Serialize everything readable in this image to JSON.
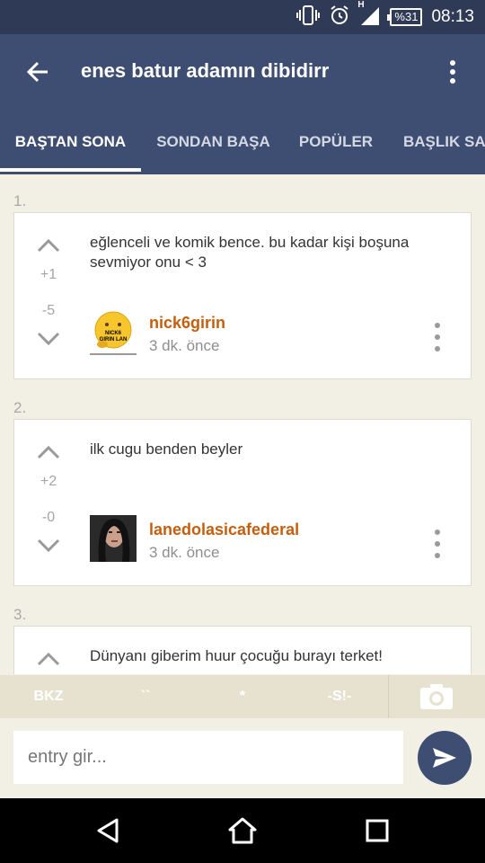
{
  "status_bar": {
    "battery": "%31",
    "time": "08:13",
    "network": "H",
    "icons": [
      "vibrate-icon",
      "alarm-icon",
      "signal-icon",
      "battery-icon"
    ]
  },
  "header": {
    "title": "enes batur adamın dibidirr",
    "tabs": [
      {
        "label": "BAŞTAN SONA",
        "active": true
      },
      {
        "label": "SONDAN BAŞA",
        "active": false
      },
      {
        "label": "POPÜLER",
        "active": false
      },
      {
        "label": "BAŞLIK SAHİBİ",
        "active": false
      }
    ]
  },
  "entries": [
    {
      "number": "1.",
      "text": "eğlenceli ve komik bence. bu kadar kişi boşuna sevmiyor onu < 3",
      "upvotes": "+1",
      "downvotes": "-5",
      "author": "nick6girin",
      "time_ago": "3 dk. önce",
      "avatar_text": "NICK6 GIRIN LAN"
    },
    {
      "number": "2.",
      "text": "ilk cugu benden beyler",
      "upvotes": "+2",
      "downvotes": "-0",
      "author": "lanedolasicafederal",
      "time_ago": "3 dk. önce"
    },
    {
      "number": "3.",
      "text": "Dünyanı giberim huur çocuğu burayı terket!"
    }
  ],
  "format_bar": {
    "buttons": [
      "BKZ",
      "``",
      "*",
      "-S!-"
    ]
  },
  "composer": {
    "placeholder": "entry gir..."
  },
  "colors": {
    "status_bar": "#2f3a57",
    "header": "#3e4d72",
    "background": "#f2efe4",
    "author": "#c65e0d",
    "format_bar": "#e7e2d0"
  }
}
